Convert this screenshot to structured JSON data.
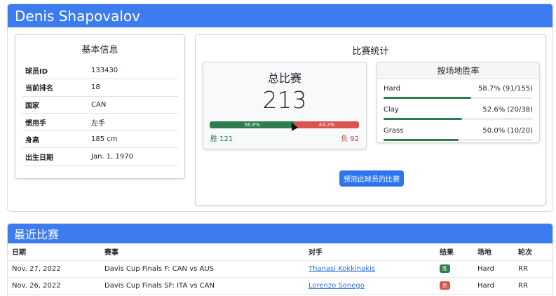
{
  "player": {
    "name": "Denis Shapovalov"
  },
  "info": {
    "title": "基本信息",
    "rows": [
      {
        "label": "球员ID",
        "value": "133430"
      },
      {
        "label": "当前排名",
        "value": "18"
      },
      {
        "label": "国家",
        "value": "CAN"
      },
      {
        "label": "惯用手",
        "value": "左手"
      },
      {
        "label": "身高",
        "value": "185 cm"
      },
      {
        "label": "出生日期",
        "value": "Jan. 1, 1970"
      }
    ]
  },
  "stats": {
    "title": "比赛统计",
    "total_title": "总比赛",
    "total": "213",
    "win_pct": 56.8,
    "loss_pct": 43.2,
    "win_pct_label": "56.8%",
    "loss_pct_label": "43.2%",
    "win_label": "胜 121",
    "loss_label": "负 92",
    "surface_title": "按场地胜率",
    "surfaces": [
      {
        "name": "Hard",
        "value": "58.7% (91/155)",
        "pct": 58.7
      },
      {
        "name": "Clay",
        "value": "52.6% (20/38)",
        "pct": 52.6
      },
      {
        "name": "Grass",
        "value": "50.0% (10/20)",
        "pct": 50.0
      }
    ],
    "predict_button": "预测此球员的比赛"
  },
  "recent": {
    "title": "最近比赛",
    "columns": [
      "日期",
      "赛事",
      "对手",
      "结果",
      "场地",
      "轮次"
    ],
    "matches": [
      {
        "date": "Nov. 27, 2022",
        "event": "Davis Cup Finals F: CAN vs AUS",
        "opponent": "Thanasi Kokkinakis",
        "result": "胜",
        "result_type": "win",
        "surface": "Hard",
        "round": "RR"
      },
      {
        "date": "Nov. 26, 2022",
        "event": "Davis Cup Finals SF: ITA vs CAN",
        "opponent": "Lorenzo Sonego",
        "result": "负",
        "result_type": "loss",
        "surface": "Hard",
        "round": "RR"
      }
    ]
  },
  "colors": {
    "primary": "#3d7cf0",
    "win": "#2e7d4f",
    "loss": "#d9534f"
  }
}
